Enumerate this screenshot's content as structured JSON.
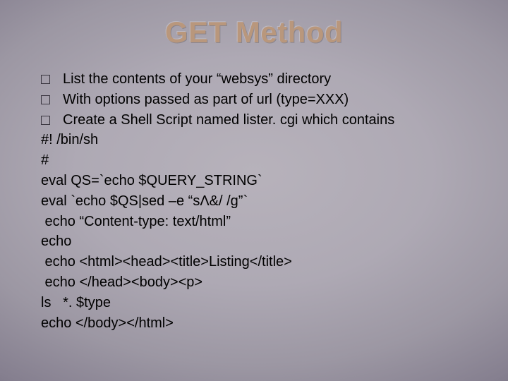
{
  "title": "GET Method",
  "bullets": [
    "List the contents of your “websys” directory",
    "With options passed as part of url (type=XXX)",
    "Create a Shell Script named lister. cgi which contains"
  ],
  "code": [
    "#! /bin/sh",
    "#",
    "eval QS=`echo $QUERY_STRING`",
    "eval `echo $QS|sed –e “sΛ&/ /g”`",
    " echo “Content-type: text/html”",
    "echo",
    " echo <html><head><title>Listing</title>",
    " echo </head><body><p>",
    "ls   *. $type",
    "echo </body></html>"
  ]
}
